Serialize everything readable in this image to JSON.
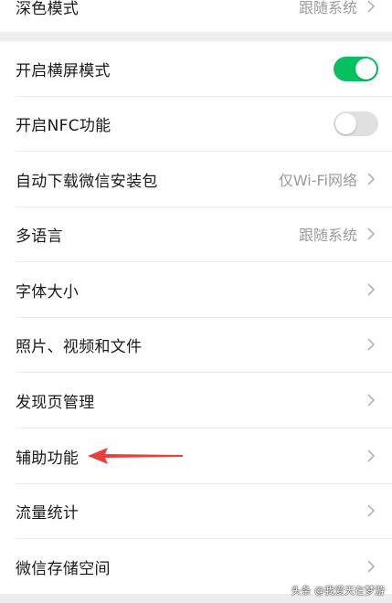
{
  "top_row": {
    "label": "深色模式",
    "value": "跟随系统"
  },
  "settings": [
    {
      "label": "开启横屏模式",
      "toggle": "on"
    },
    {
      "label": "开启NFC功能",
      "toggle": "off"
    },
    {
      "label": "自动下载微信安装包",
      "value": "仅Wi-Fi网络"
    },
    {
      "label": "多语言",
      "value": "跟随系统"
    },
    {
      "label": "字体大小",
      "value": ""
    },
    {
      "label": "照片、视频和文件",
      "value": ""
    },
    {
      "label": "发现页管理",
      "value": ""
    },
    {
      "label": "辅助功能",
      "value": ""
    },
    {
      "label": "流量统计",
      "value": ""
    },
    {
      "label": "微信存储空间",
      "value": ""
    }
  ],
  "annotation": {
    "arrow_color": "#e8403a"
  },
  "watermark": "头条 @我爱天在梦游",
  "colors": {
    "toggle_on": "#07c160",
    "toggle_off": "#e0e0e0",
    "background": "#ededed"
  }
}
